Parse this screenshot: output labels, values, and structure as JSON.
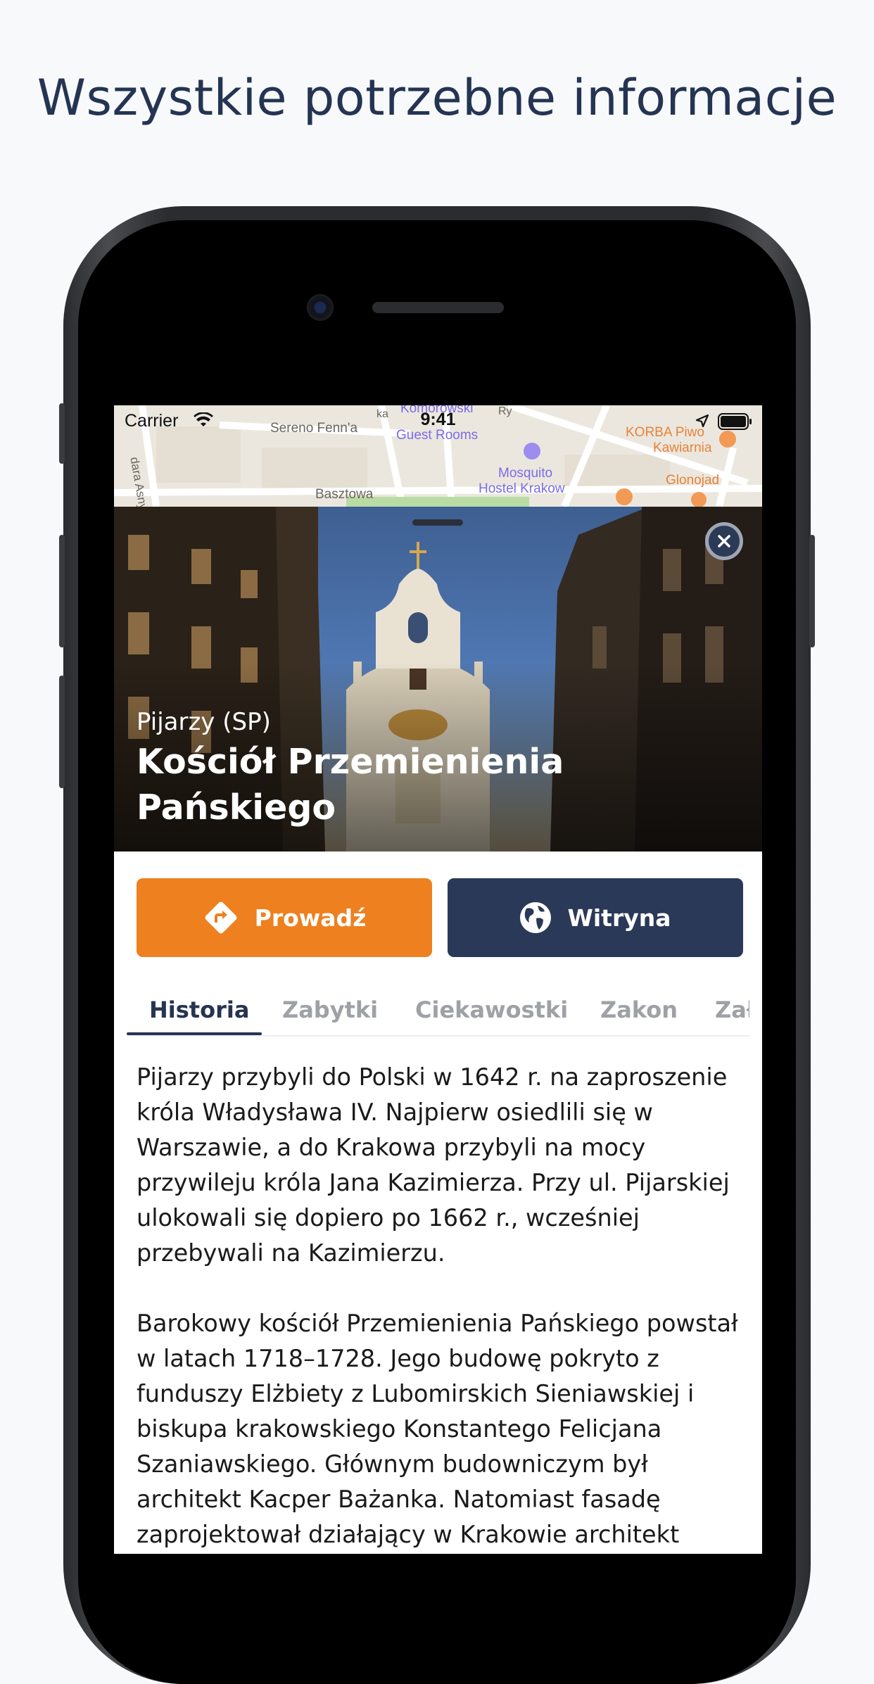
{
  "headline": "Wszystkie potrzebne informacje",
  "status_bar": {
    "carrier": "Carrier",
    "time": "9:41"
  },
  "map": {
    "labels": {
      "street_asnyka": "dara Asnyka",
      "street_sereno": "Sereno Fenn'a",
      "street_basztowa": "Basztowa",
      "komorowski": "Komorowski",
      "guest_rooms": "Guest Rooms",
      "ry": "Ry",
      "ka": "ka",
      "korba": "KORBA Piwo",
      "kawiarnia": "Kawiarnia",
      "mosquito": "Mosquito",
      "hostel": "Hostel Krakow",
      "glonojad": "Glonojad"
    }
  },
  "hero": {
    "subtitle": "Pijarzy (SP)",
    "title": "Kościół Przemienienia Pańskiego"
  },
  "actions": {
    "guide_label": "Prowadź",
    "website_label": "Witryna"
  },
  "tabs": [
    "Historia",
    "Zabytki",
    "Ciekawostki",
    "Zakon",
    "Zał"
  ],
  "content": {
    "paragraph_1": "Pijarzy przybyli do Polski w 1642 r. na zaproszenie króla Władysława IV. Najpierw osiedlili się w Warszawie, a do Krakowa przybyli na mocy przywileju króla Jana Kazimierza. Przy ul. Pijarskiej ulokowali się dopiero po 1662 r., wcześniej przebywali na Kazimierzu.",
    "paragraph_2": "Barokowy kościół Przemienienia Pańskiego powstał w latach 1718–1728. Jego budowę pokryto z funduszy Elżbiety z Lubomirskich Sieniawskiej i biskupa krakowskiego Konstantego Felicjana Szaniawskiego. Głównym budowniczym był architekt Kacper Bażanka. Natomiast fasadę zaprojektował działający w Krakowie architekt"
  },
  "colors": {
    "accent_orange": "#ee801f",
    "navy": "#2a3957",
    "headline": "#243452"
  }
}
